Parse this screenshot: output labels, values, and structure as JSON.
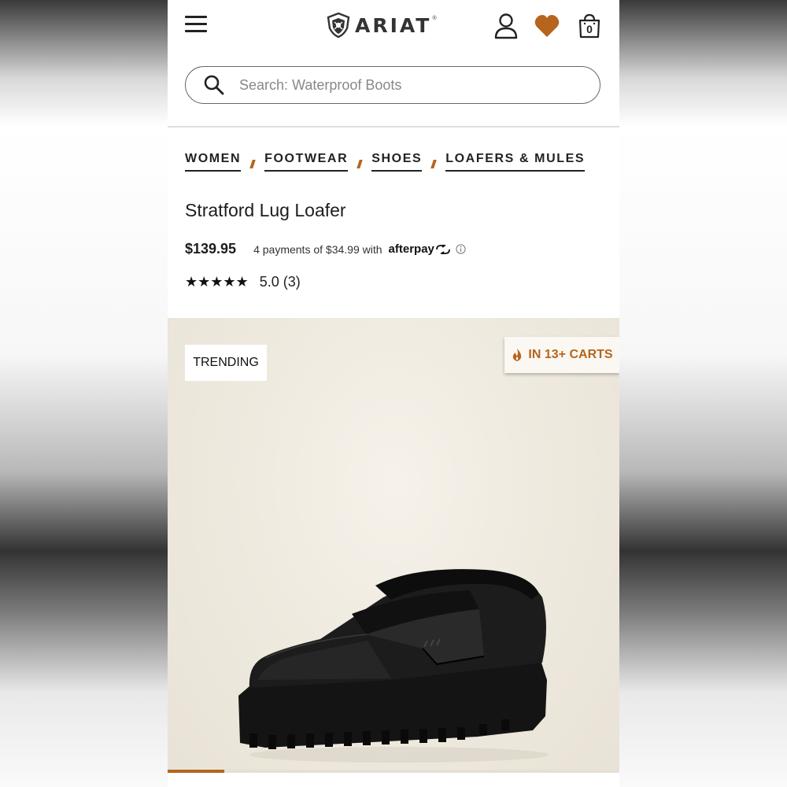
{
  "header": {
    "logo_text": "ARIAT",
    "logo_reg": "®",
    "menu_icon": "hamburger-icon",
    "account_icon": "user-icon",
    "wishlist_icon": "heart-icon",
    "wishlist_color": "#b5651d",
    "cart_icon": "shopping-bag-icon",
    "cart_count": "0"
  },
  "search": {
    "placeholder": "Search:  Waterproof Boots",
    "icon": "search-icon"
  },
  "breadcrumb": {
    "items": [
      {
        "label": "WOMEN"
      },
      {
        "label": "FOOTWEAR"
      },
      {
        "label": "SHOES"
      },
      {
        "label": "LOAFERS & MULES"
      }
    ],
    "separator_color": "#b5651d"
  },
  "product": {
    "title": "Stratford Lug Loafer",
    "price": "$139.95",
    "installments_text": "4 payments of $34.99  with",
    "afterpay_label": "afterpay",
    "rating_stars": "★★★★★",
    "rating_text": "5.0 (3)",
    "rating_value": 5.0,
    "review_count": 3
  },
  "gallery": {
    "badge_left": "TRENDING",
    "badge_right": "IN 13+ CARTS",
    "badge_right_icon": "flame-icon",
    "accent_color": "#b5651d",
    "progress_fraction": 0.125,
    "image_alt_icon": "loafer-shoe-image"
  }
}
